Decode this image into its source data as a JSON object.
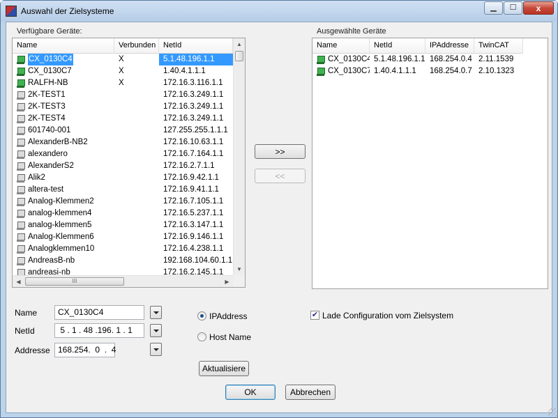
{
  "window": {
    "title": "Auswahl der Zielsysteme"
  },
  "titlebar": {
    "minimize_glyph": "▁",
    "maximize_glyph": "☐",
    "close_glyph": "x"
  },
  "left_group": {
    "label": "Verfügbare Geräte:",
    "columns": [
      "Name",
      "Verbunden",
      "NetId"
    ],
    "rows": [
      {
        "name": "CX_0130C4",
        "connected": "X",
        "netid": "5.1.48.196.1.1",
        "online": true,
        "selected": true
      },
      {
        "name": "CX_0130C7",
        "connected": "X",
        "netid": "1.40.4.1.1.1",
        "online": true
      },
      {
        "name": "RALFH-NB",
        "connected": "X",
        "netid": "172.16.3.116.1.1",
        "online": true
      },
      {
        "name": "2K-TEST1",
        "connected": "",
        "netid": "172.16.3.249.1.1"
      },
      {
        "name": "2K-TEST3",
        "connected": "",
        "netid": "172.16.3.249.1.1"
      },
      {
        "name": "2K-TEST4",
        "connected": "",
        "netid": "172.16.3.249.1.1"
      },
      {
        "name": "601740-001",
        "connected": "",
        "netid": "127.255.255.1.1.1"
      },
      {
        "name": "AlexanderB-NB2",
        "connected": "",
        "netid": "172.16.10.63.1.1"
      },
      {
        "name": "alexandero",
        "connected": "",
        "netid": "172.16.7.164.1.1"
      },
      {
        "name": "AlexanderS2",
        "connected": "",
        "netid": "172.16.2.7.1.1"
      },
      {
        "name": "Alik2",
        "connected": "",
        "netid": "172.16.9.42.1.1"
      },
      {
        "name": "altera-test",
        "connected": "",
        "netid": "172.16.9.41.1.1"
      },
      {
        "name": "Analog-Klemmen2",
        "connected": "",
        "netid": "172.16.7.105.1.1"
      },
      {
        "name": "analog-klemmen4",
        "connected": "",
        "netid": "172.16.5.237.1.1"
      },
      {
        "name": "analog-klemmen5",
        "connected": "",
        "netid": "172.16.3.147.1.1"
      },
      {
        "name": "Analog-Klemmen6",
        "connected": "",
        "netid": "172.16.9.146.1.1"
      },
      {
        "name": "Analogklemmen10",
        "connected": "",
        "netid": "172.16.4.238.1.1"
      },
      {
        "name": "AndreasB-nb",
        "connected": "",
        "netid": "192.168.104.60.1.1"
      },
      {
        "name": "andreasi-nb",
        "connected": "",
        "netid": "172.16.2.145.1.1"
      }
    ],
    "hscroll_grip": "III",
    "up_arrow": "▲",
    "down_arrow": "▼",
    "left_arrow": "◀",
    "right_arrow": "▶"
  },
  "right_group": {
    "label": "Ausgewählte Geräte",
    "columns": [
      "Name",
      "NetId",
      "IPAddresse",
      "TwinCAT"
    ],
    "rows": [
      {
        "name": "CX_0130C4",
        "netid": "5.1.48.196.1.1",
        "ip": "168.254.0.4",
        "twincat": "2.11.1539"
      },
      {
        "name": "CX_0130C7",
        "netid": "1.40.4.1.1.1",
        "ip": "168.254.0.7",
        "twincat": "2.10.1323"
      }
    ]
  },
  "transfer": {
    "add_label": ">>",
    "remove_label": "<<"
  },
  "form": {
    "name_label": "Name",
    "name_value": "CX_0130C4",
    "netid_label": "NetId",
    "netid_value": " 5 . 1 . 48 .196. 1 . 1",
    "address_label": "Addresse",
    "address_value": "168.254.  0  .  4",
    "radio_ip_label": "IPAddress",
    "radio_host_label": "Host Name",
    "radio_selected": "ip",
    "refresh_label": "Aktualisiere",
    "load_config_label": "Lade Configuration vom Zielsystem",
    "load_config_checked": true
  },
  "footer": {
    "ok_label": "OK",
    "cancel_label": "Abbrechen"
  },
  "icons": [
    "app-icon",
    "device-online-icon",
    "device-offline-icon",
    "chevron-down-icon"
  ]
}
